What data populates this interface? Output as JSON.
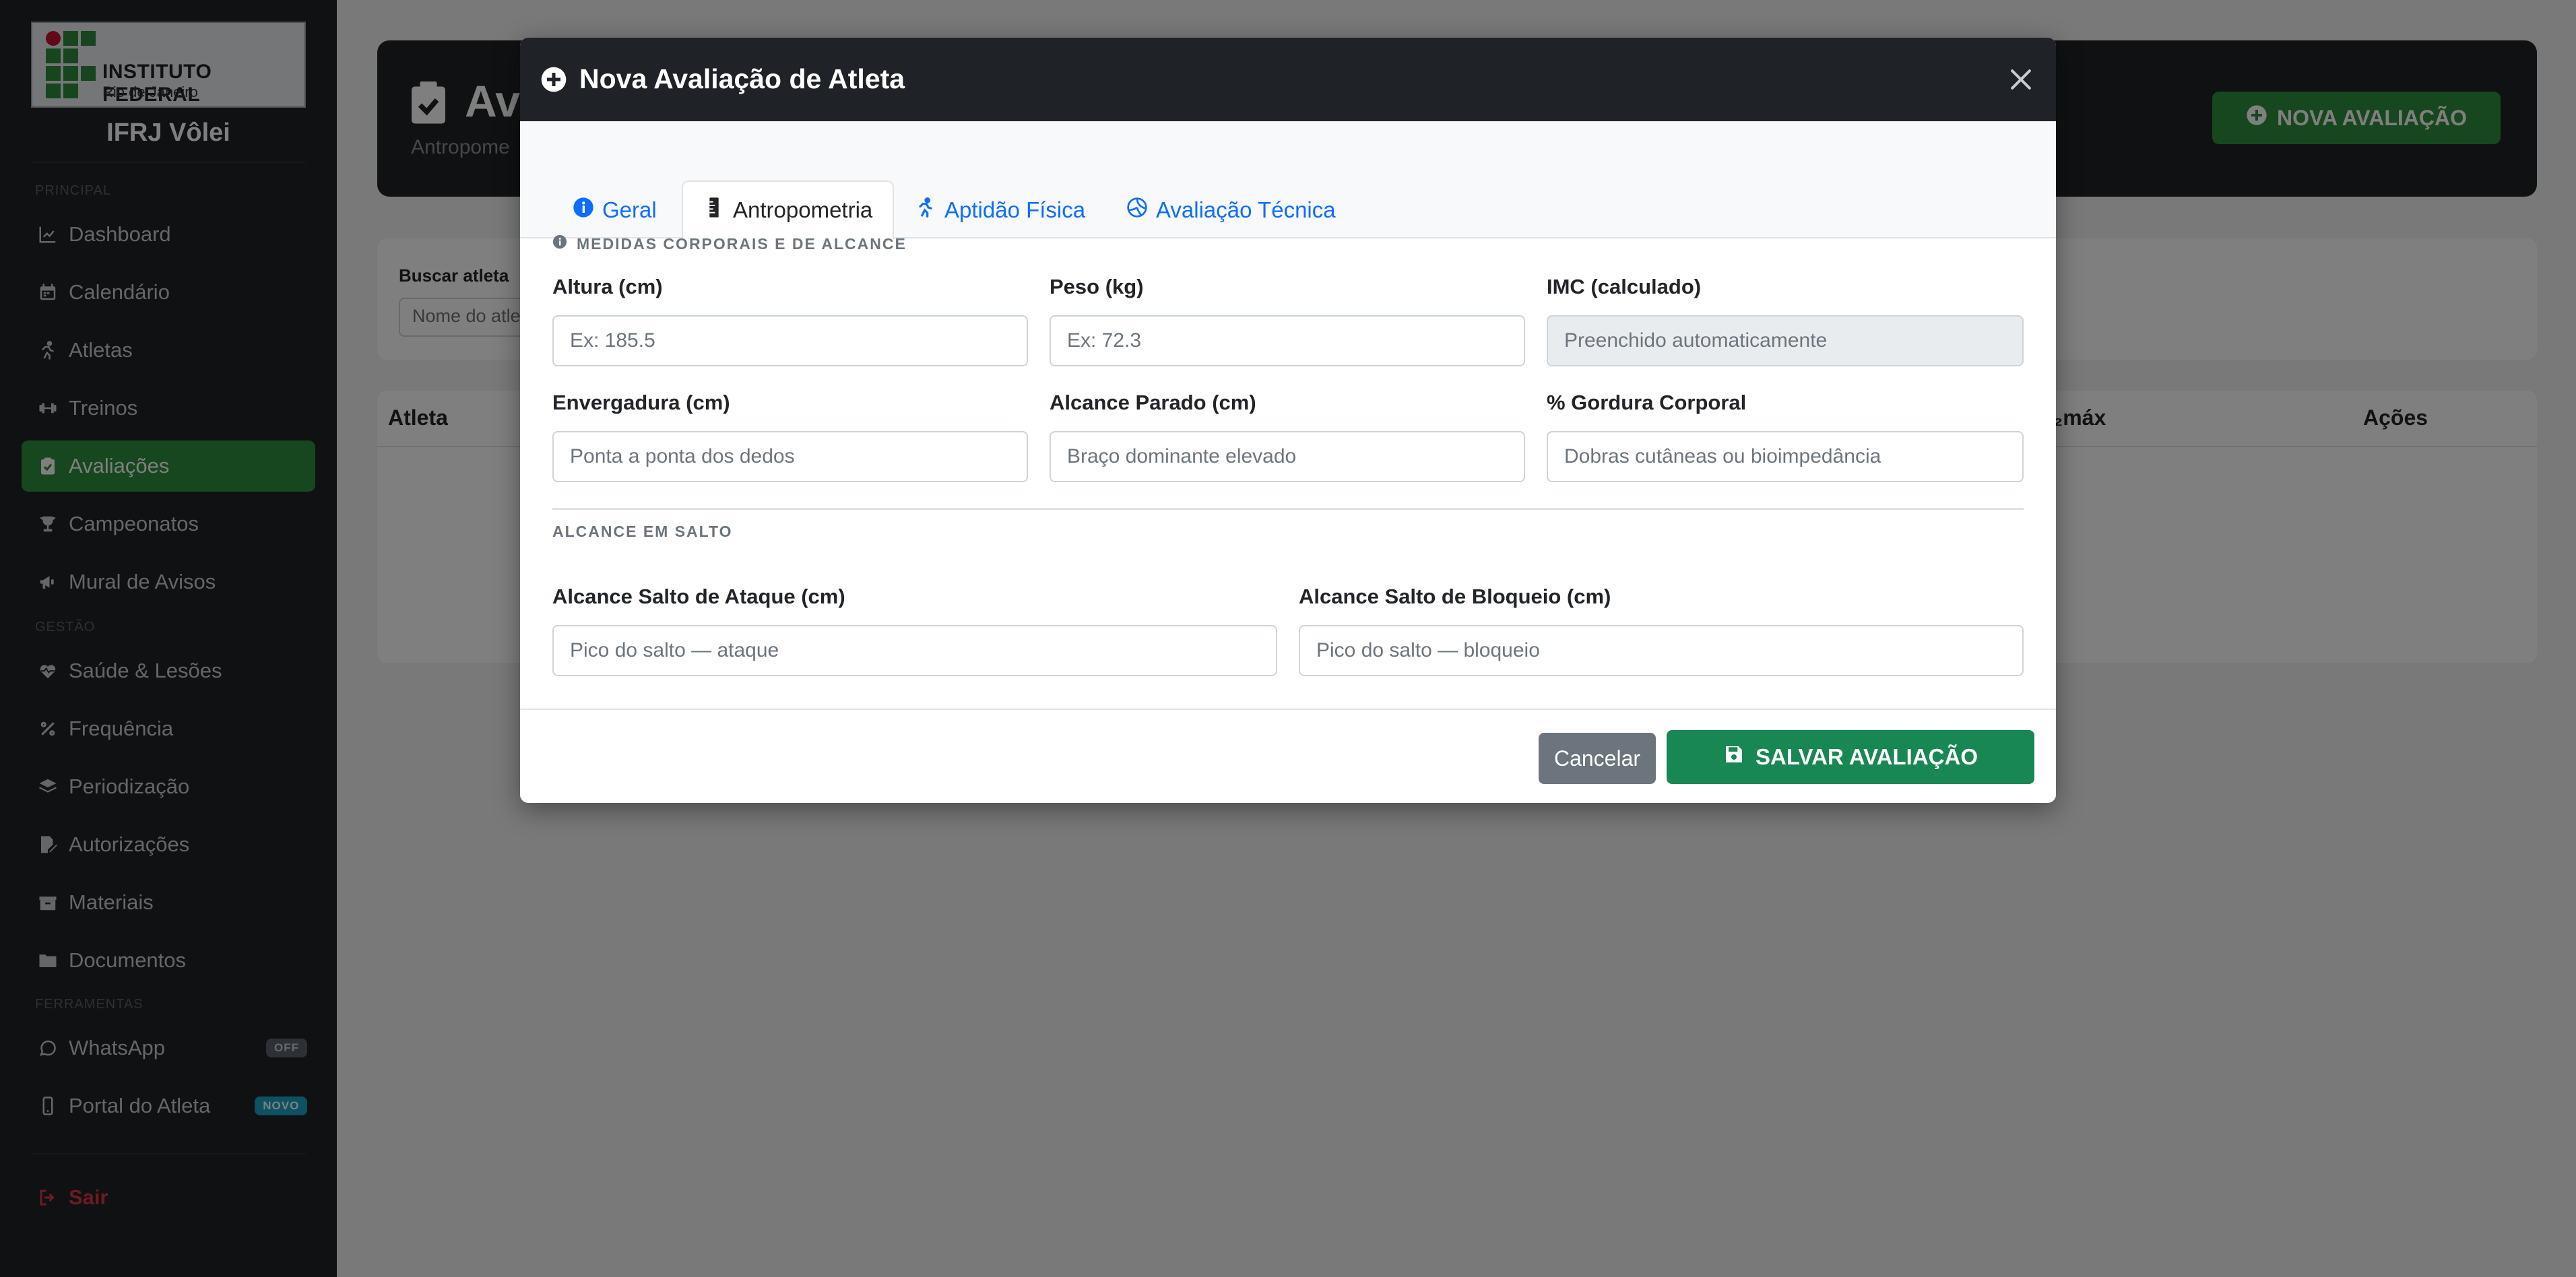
{
  "sidebar": {
    "logo_title": "INSTITUTO FEDERAL",
    "logo_subtitle": "Rio de Janeiro",
    "brand": "IFRJ Vôlei",
    "sections": {
      "principal": "PRINCIPAL",
      "gestao": "GESTÃO",
      "ferramentas": "FERRAMENTAS"
    },
    "items": [
      {
        "label": "Dashboard",
        "icon": "chart-line-icon"
      },
      {
        "label": "Calendário",
        "icon": "calendar-icon"
      },
      {
        "label": "Atletas",
        "icon": "running-icon"
      },
      {
        "label": "Treinos",
        "icon": "dumbbell-icon"
      },
      {
        "label": "Avaliações",
        "icon": "clipboard-check-icon",
        "active": true
      },
      {
        "label": "Campeonatos",
        "icon": "trophy-icon"
      },
      {
        "label": "Mural de Avisos",
        "icon": "megaphone-icon"
      },
      {
        "label": "Saúde & Lesões",
        "icon": "heart-pulse-icon"
      },
      {
        "label": "Frequência",
        "icon": "percent-icon"
      },
      {
        "label": "Periodização",
        "icon": "layers-icon"
      },
      {
        "label": "Autorizações",
        "icon": "file-signature-icon"
      },
      {
        "label": "Materiais",
        "icon": "box-icon"
      },
      {
        "label": "Documentos",
        "icon": "folder-icon"
      },
      {
        "label": "WhatsApp",
        "icon": "whatsapp-icon",
        "badge": "OFF"
      },
      {
        "label": "Portal do Atleta",
        "icon": "mobile-icon",
        "badge": "NOVO"
      }
    ],
    "logout": "Sair"
  },
  "page": {
    "title": "Ava",
    "subtitle": "Antropome",
    "new_button": "NOVA AVALIAÇÃO",
    "search_label": "Buscar atleta",
    "search_placeholder": "Nome do atle",
    "table_headers": {
      "atleta": "Atleta",
      "vo2": "₂máx",
      "acoes": "Ações"
    }
  },
  "modal": {
    "title": "Nova Avaliação de Atleta",
    "tabs": [
      {
        "label": "Geral",
        "icon": "info-circle-icon"
      },
      {
        "label": "Antropometria",
        "icon": "ruler-icon",
        "active": true
      },
      {
        "label": "Aptidão Física",
        "icon": "running-icon"
      },
      {
        "label": "Avaliação Técnica",
        "icon": "volleyball-icon"
      }
    ],
    "section_body": "MEDIDAS CORPORAIS E DE ALCANCE",
    "section_jump": "ALCANCE EM SALTO",
    "fields": {
      "altura": {
        "label": "Altura (cm)",
        "placeholder": "Ex: 185.5"
      },
      "peso": {
        "label": "Peso (kg)",
        "placeholder": "Ex: 72.3"
      },
      "imc": {
        "label": "IMC (calculado)",
        "placeholder": "Preenchido automaticamente"
      },
      "envergadura": {
        "label": "Envergadura (cm)",
        "placeholder": "Ponta a ponta dos dedos"
      },
      "alcance_parado": {
        "label": "Alcance Parado (cm)",
        "placeholder": "Braço dominante elevado"
      },
      "gordura": {
        "label": "% Gordura Corporal",
        "placeholder": "Dobras cutâneas ou bioimpedância"
      },
      "salto_ataque": {
        "label": "Alcance Salto de Ataque (cm)",
        "placeholder": "Pico do salto — ataque"
      },
      "salto_bloqueio": {
        "label": "Alcance Salto de Bloqueio (cm)",
        "placeholder": "Pico do salto — bloqueio"
      }
    },
    "cancel": "Cancelar",
    "save": "SALVAR AVALIAÇÃO"
  },
  "colors": {
    "sidebar_bg": "#1f2327",
    "accent_green": "#2f8f3c",
    "save_green": "#198754",
    "tab_blue": "#0d6efd",
    "logout_red": "#dc3545"
  }
}
